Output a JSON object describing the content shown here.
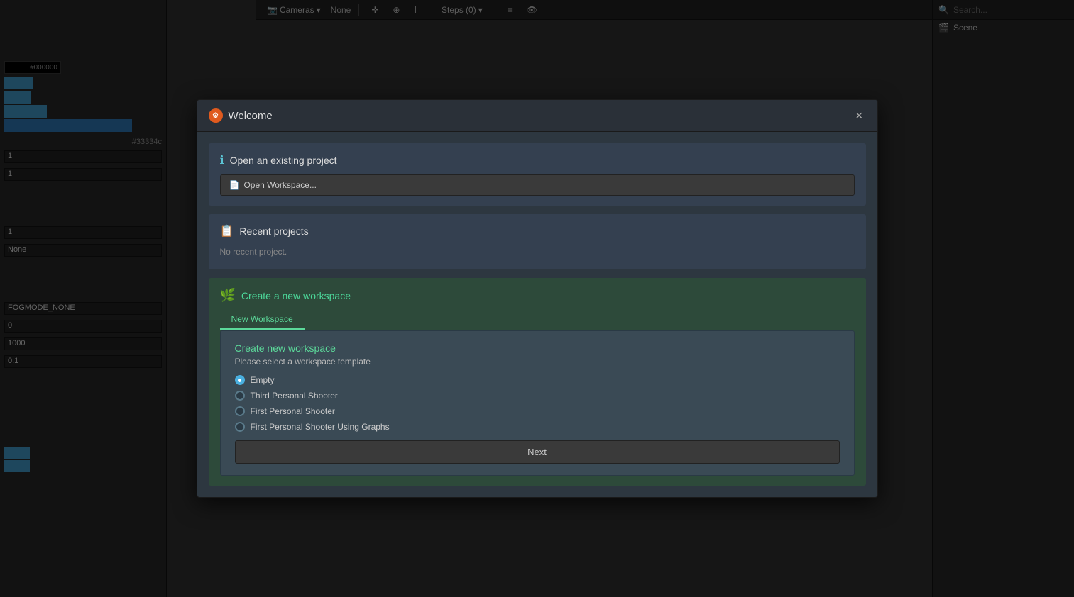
{
  "app": {
    "background_color": "#2c2c2c"
  },
  "toolbar": {
    "cameras_label": "Cameras",
    "none_label": "None",
    "steps_label": "Steps (0)",
    "search_placeholder": "Search..."
  },
  "right_panel": {
    "search_placeholder": "Search...",
    "scene_label": "Scene"
  },
  "modal": {
    "title": "Welcome",
    "close_label": "×",
    "icon_label": "⚙",
    "sections": {
      "open": {
        "title": "Open an existing project",
        "open_workspace_label": "Open Workspace..."
      },
      "recent": {
        "title": "Recent projects",
        "no_recent_label": "No recent project."
      },
      "create": {
        "title": "Create a new workspace",
        "tab_label": "New Workspace",
        "form_title": "Create new workspace",
        "form_subtitle": "Please select a workspace template",
        "next_button_label": "Next",
        "templates": [
          {
            "id": "empty",
            "label": "Empty",
            "selected": true
          },
          {
            "id": "third-person-shooter",
            "label": "Third Personal Shooter",
            "selected": false
          },
          {
            "id": "first-person-shooter",
            "label": "First Personal Shooter",
            "selected": false
          },
          {
            "id": "first-person-shooter-graphs",
            "label": "First Personal Shooter Using Graphs",
            "selected": false
          }
        ]
      }
    }
  },
  "left_panel": {
    "color_hex1": "#000000",
    "color_hex2": "#33334c",
    "values": [
      "1",
      "1",
      "1",
      "None",
      "FOGMODE_NONE",
      "0",
      "1000",
      "0.1"
    ]
  }
}
